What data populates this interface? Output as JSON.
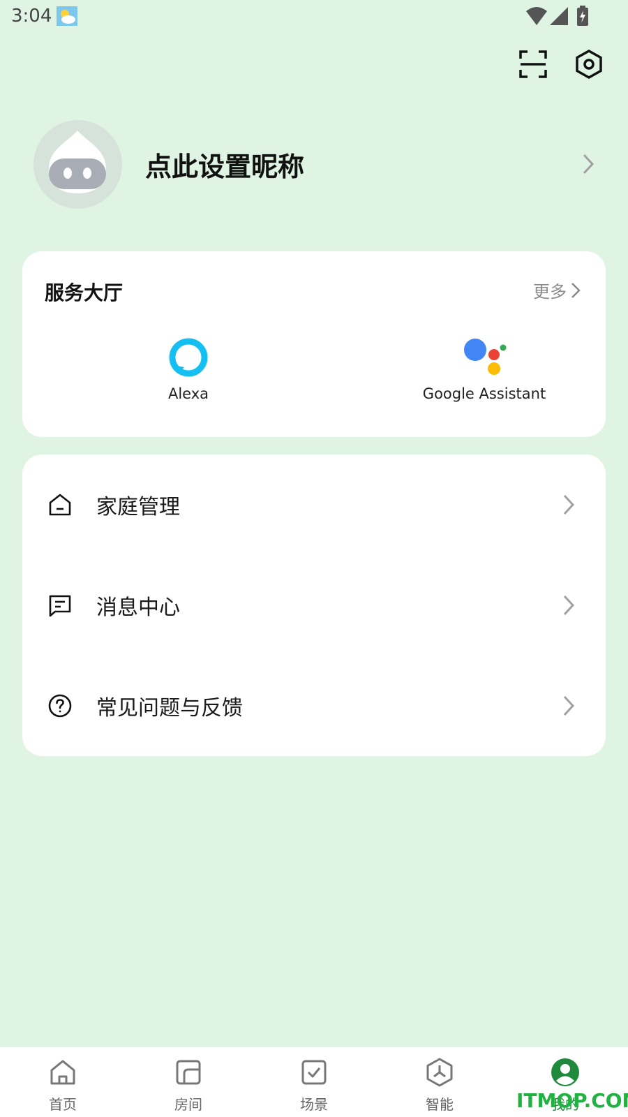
{
  "status_bar": {
    "time": "3:04"
  },
  "profile": {
    "nickname": "点此设置昵称"
  },
  "service_hall": {
    "title": "服务大厅",
    "more_label": "更多",
    "items": [
      {
        "label": "Alexa",
        "icon": "alexa-icon"
      },
      {
        "label": "Google Assistant",
        "icon": "google-assistant-icon"
      }
    ]
  },
  "menu": {
    "items": [
      {
        "label": "家庭管理",
        "icon": "home-icon"
      },
      {
        "label": "消息中心",
        "icon": "message-icon"
      },
      {
        "label": "常见问题与反馈",
        "icon": "help-icon"
      }
    ]
  },
  "bottom_nav": {
    "items": [
      {
        "label": "首页",
        "icon": "home-icon"
      },
      {
        "label": "房间",
        "icon": "room-icon"
      },
      {
        "label": "场景",
        "icon": "scene-icon"
      },
      {
        "label": "智能",
        "icon": "smart-icon"
      },
      {
        "label": "我的",
        "icon": "profile-icon",
        "active": true
      }
    ]
  },
  "watermark": "ITMOP.COM",
  "colors": {
    "background": "#dff4e3",
    "accent": "#1f8a3c",
    "alexa": "#16bff2"
  }
}
